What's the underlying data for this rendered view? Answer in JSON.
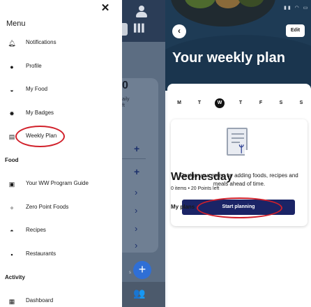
{
  "drawer": {
    "title": "Menu",
    "close_icon": "close-icon",
    "items": [
      {
        "label": "Notifications",
        "icon": "bell-icon"
      },
      {
        "label": "Profile",
        "icon": "person-icon"
      },
      {
        "label": "My Food",
        "icon": "bowl-icon"
      },
      {
        "label": "My Badges",
        "icon": "badge-icon"
      },
      {
        "label": "Weekly Plan",
        "icon": "calendar-icon"
      }
    ],
    "food_section": "Food",
    "food_items": [
      {
        "label": "Your WW Program Guide",
        "icon": "book-icon"
      },
      {
        "label": "Zero Point Foods",
        "icon": "zero-point-icon"
      },
      {
        "label": "Recipes",
        "icon": "recipe-icon"
      },
      {
        "label": "Restaurants",
        "icon": "restaurant-icon"
      }
    ],
    "activity_section": "Activity",
    "activity_items": [
      {
        "label": "Dashboard",
        "icon": "dashboard-icon"
      }
    ]
  },
  "background_app": {
    "stat": "0",
    "stat_sub": "aily\nft",
    "barcode_icon": "barcode-icon",
    "bottom_label": "s"
  },
  "plan": {
    "edit_label": "Edit",
    "title": "Your weekly plan",
    "days": [
      "M",
      "T",
      "W",
      "T",
      "F",
      "S",
      "S"
    ],
    "active_day_index": 2,
    "description": "Design your menu by adding foods, recipes and meals ahead of time.",
    "cta_label": "Start planning",
    "weekday": "Wednesday",
    "summary": "0 items • 20 Points left",
    "my_plans": "My plans"
  },
  "colors": {
    "highlight_ring": "#d1202a",
    "cta": "#1b2466",
    "hero": "#1e3b55"
  }
}
